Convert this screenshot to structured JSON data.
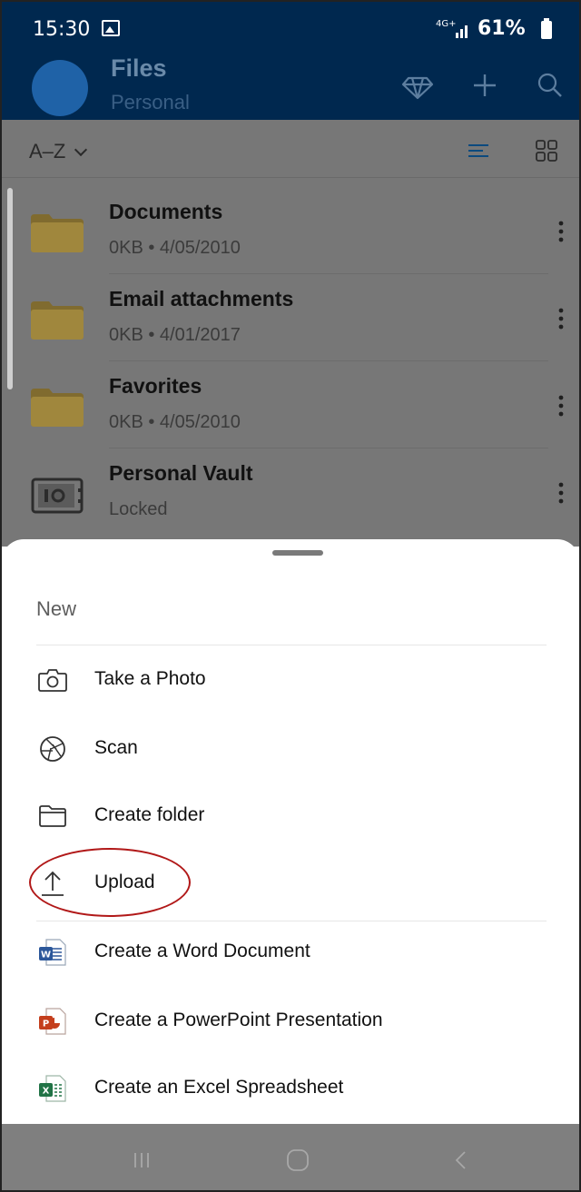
{
  "status_bar": {
    "time": "15:30",
    "network": "4G+",
    "battery": "61%"
  },
  "app_bar": {
    "title": "Files",
    "subtitle": "Personal",
    "actions": [
      "premium-diamond-icon",
      "add-icon",
      "search-icon"
    ]
  },
  "sort": {
    "label": "A–Z"
  },
  "files": [
    {
      "name": "Documents",
      "meta": "0KB • 4/05/2010",
      "icon": "folder-icon"
    },
    {
      "name": "Email attachments",
      "meta": "0KB • 4/01/2017",
      "icon": "folder-icon"
    },
    {
      "name": "Favorites",
      "meta": "0KB • 4/05/2010",
      "icon": "folder-icon"
    },
    {
      "name": "Personal Vault",
      "meta": "Locked",
      "icon": "vault-icon"
    }
  ],
  "sheet": {
    "header": "New",
    "items": [
      {
        "label": "Take a Photo",
        "icon": "camera-icon"
      },
      {
        "label": "Scan",
        "icon": "aperture-icon"
      },
      {
        "label": "Create folder",
        "icon": "folder-outline-icon"
      },
      {
        "label": "Upload",
        "icon": "upload-icon"
      },
      {
        "label": "Create a Word Document",
        "icon": "word-icon"
      },
      {
        "label": "Create a PowerPoint Presentation",
        "icon": "powerpoint-icon"
      },
      {
        "label": "Create an Excel Spreadsheet",
        "icon": "excel-icon"
      }
    ]
  },
  "colors": {
    "app_bar": "#00284f",
    "folder": "#a0873d",
    "highlight": "#b11818",
    "word": "#2b579a",
    "powerpoint": "#c43e1c",
    "excel": "#217346"
  }
}
